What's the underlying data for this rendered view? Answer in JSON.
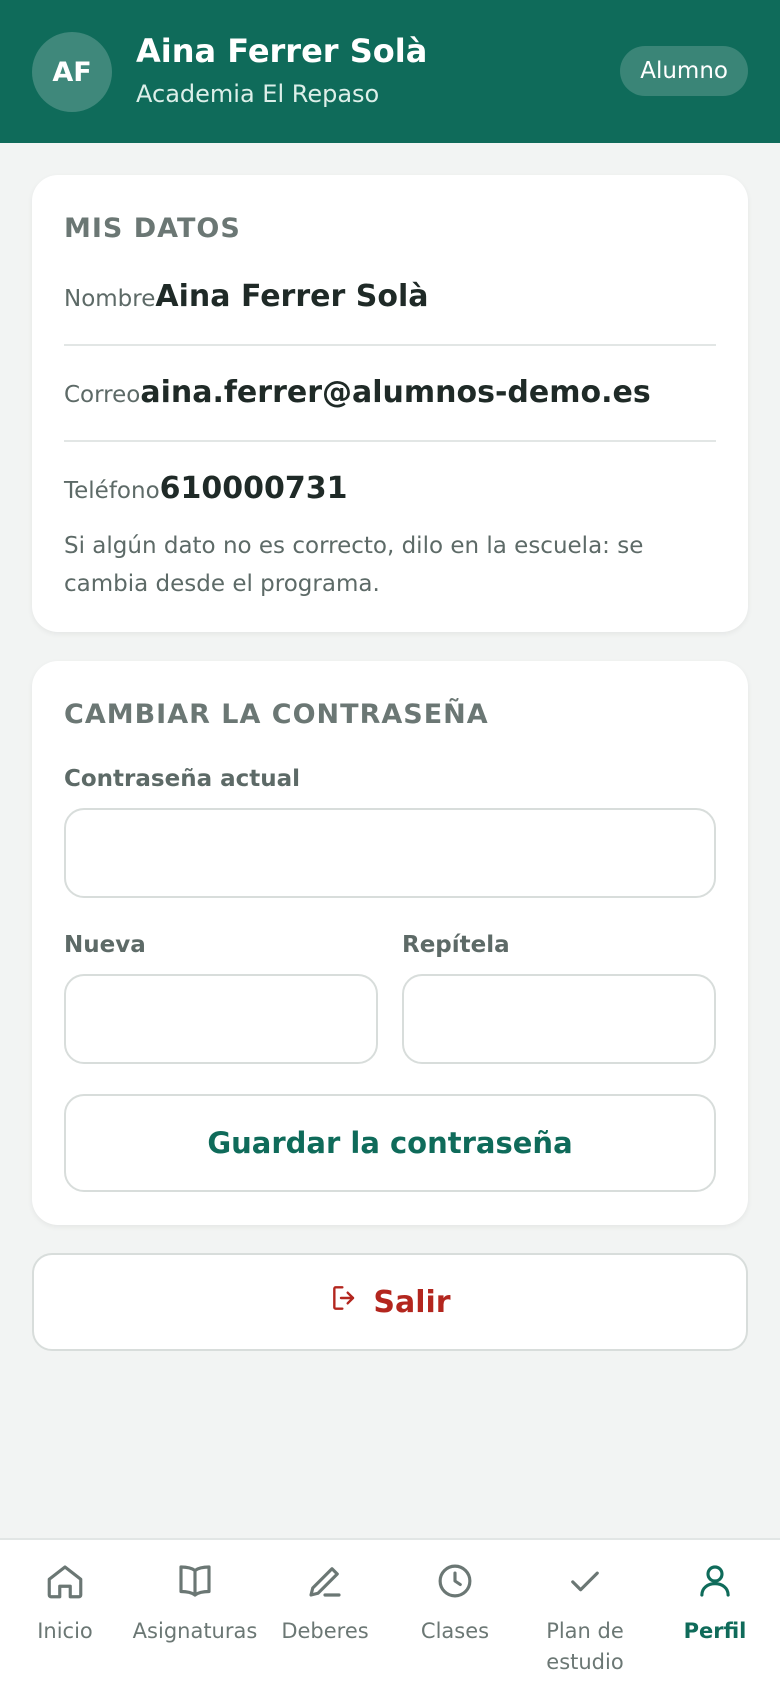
{
  "header": {
    "avatar_initials": "AF",
    "user_name": "Aina Ferrer Solà",
    "school": "Academia El Repaso",
    "role_badge": "Alumno"
  },
  "my_data": {
    "title": "MIS DATOS",
    "name_label": "Nombre",
    "name_value": "Aina Ferrer Solà",
    "email_label": "Correo",
    "email_value": "aina.ferrer@alumnos-demo.es",
    "phone_label": "Teléfono",
    "phone_value": "610000731",
    "note": "Si algún dato no es correcto, dilo en la escuela: se cambia desde el programa."
  },
  "password": {
    "title": "CAMBIAR LA CONTRASEÑA",
    "current_label": "Contraseña actual",
    "current_value": "",
    "new_label": "Nueva",
    "new_value": "",
    "repeat_label": "Repítela",
    "repeat_value": "",
    "save_label": "Guardar la contraseña"
  },
  "logout": {
    "label": "Salir",
    "icon": "logout-icon"
  },
  "nav": {
    "items": [
      {
        "label": "Inicio",
        "icon": "home-icon"
      },
      {
        "label": "Asignaturas",
        "icon": "book-icon"
      },
      {
        "label": "Deberes",
        "icon": "pencil-icon"
      },
      {
        "label": "Clases",
        "icon": "clock-icon"
      },
      {
        "label": "Plan de estudio",
        "icon": "check-icon"
      },
      {
        "label": "Perfil",
        "icon": "user-icon",
        "active": true
      }
    ]
  },
  "colors": {
    "brand": "#0f6b5a",
    "danger": "#b3261e",
    "background": "#f2f4f3"
  }
}
